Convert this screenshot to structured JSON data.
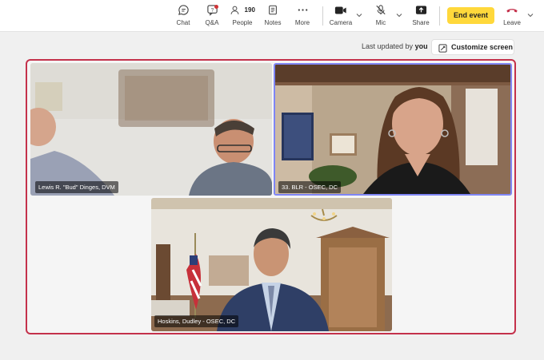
{
  "toolbar": {
    "chat_label": "Chat",
    "qa_label": "Q&A",
    "people_label": "People",
    "people_count": "190",
    "notes_label": "Notes",
    "more_label": "More",
    "camera_label": "Camera",
    "mic_label": "Mic",
    "share_label": "Share",
    "end_event_label": "End event",
    "leave_label": "Leave"
  },
  "header": {
    "updated_prefix": "Last updated by",
    "updated_by": "you",
    "customize_label": "Customize screen"
  },
  "participants": [
    {
      "name": "Lewis R. \"Bud\" Dinges, DVM"
    },
    {
      "name": "33. BLR - OSEC, DC"
    },
    {
      "name": "Hoskins, Dudley - OSEC, DC"
    }
  ],
  "colors": {
    "end_event_bg": "#ffd83b",
    "stage_border": "#c4314b",
    "selected_tile_border": "#7f85f5",
    "leave_icon": "#c4314b"
  },
  "icons": [
    "chat-icon",
    "qa-icon",
    "people-icon",
    "notes-icon",
    "more-icon",
    "camera-icon",
    "mic-off-icon",
    "share-icon",
    "leave-phone-icon",
    "customize-icon"
  ]
}
